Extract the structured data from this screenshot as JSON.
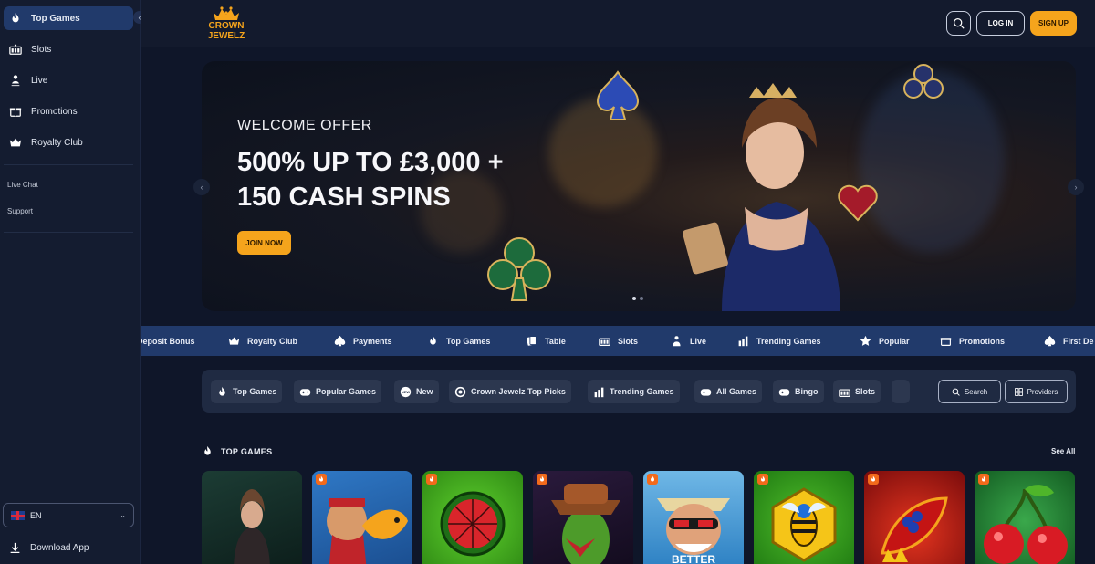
{
  "sidebar": {
    "items": [
      {
        "label": "Top Games",
        "icon": "flame-icon",
        "active": true
      },
      {
        "label": "Slots",
        "icon": "slots-icon"
      },
      {
        "label": "Live",
        "icon": "dealer-icon"
      },
      {
        "label": "Promotions",
        "icon": "gift-icon"
      },
      {
        "label": "Royalty Club",
        "icon": "crown-icon"
      }
    ],
    "links": [
      "Live Chat",
      "Support"
    ],
    "language": "EN",
    "download": "Download App"
  },
  "header": {
    "logo_text": "CROWN JEWELZ",
    "login": "LOG IN",
    "signup": "SIGN UP"
  },
  "hero": {
    "subtitle": "WELCOME OFFER",
    "title_line1": "500% UP TO £3,000 +",
    "title_line2": "150 CASH SPINS",
    "cta": "JOIN NOW"
  },
  "category_strip": [
    "Deposit Bonus",
    "Royalty Club",
    "Payments",
    "Top Games",
    "Table",
    "Slots",
    "Live",
    "Trending Games",
    "Popular",
    "Promotions",
    "First De"
  ],
  "filters": {
    "chips": [
      "Top Games",
      "Popular Games",
      "New",
      "Crown Jewelz Top Picks",
      "Trending Games",
      "All Games",
      "Bingo",
      "Slots"
    ],
    "search": "Search",
    "providers": "Providers"
  },
  "section": {
    "title": "TOP GAMES",
    "see_all": "See All",
    "card_caption": "BETTER"
  },
  "colors": {
    "accent": "#f5a41c",
    "nav_active": "#213a6b",
    "background": "#0f1629"
  }
}
